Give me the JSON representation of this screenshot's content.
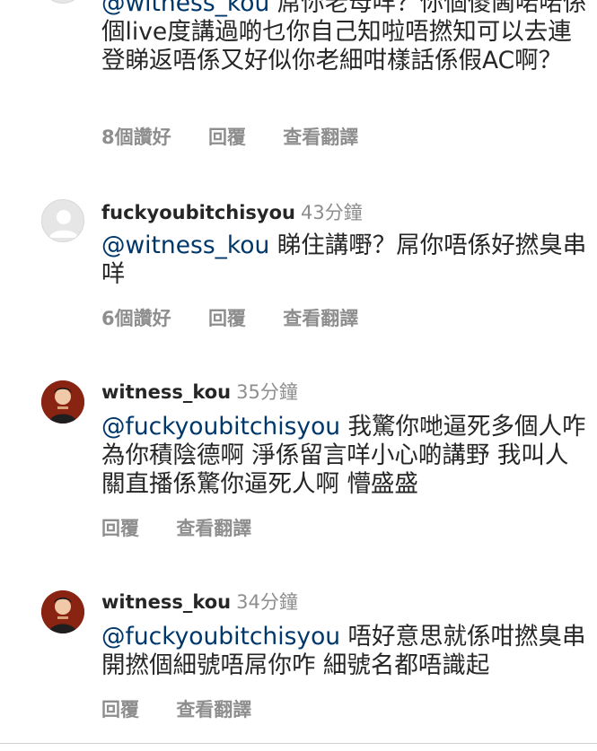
{
  "comments": [
    {
      "mention": "@witness_kou",
      "text": " 屌你老母咩？你個傻閪啱啱係個live度講過啲乜你自己知啦唔撚知可以去連登睇返唔係又好似你老細咁樣話係假AC啊？",
      "likes": "8個讚好",
      "reply": "回覆",
      "translate": "查看翻譯"
    },
    {
      "username": "fuckyoubitchisyou",
      "time": "43分鐘",
      "mention": "@witness_kou",
      "text": " 睇住講嘢？屌你唔係好撚臭串咩",
      "likes": "6個讚好",
      "reply": "回覆",
      "translate": "查看翻譯"
    },
    {
      "username": "witness_kou",
      "time": "35分鐘",
      "mention": "@fuckyoubitchisyou",
      "text": " 我驚你哋逼死多個人咋 為你積陰德啊 淨係留言咩小心啲講野 我叫人關直播係驚你逼死人啊 懵盛盛",
      "reply": "回覆",
      "translate": "查看翻譯"
    },
    {
      "username": "witness_kou",
      "time": "34分鐘",
      "mention": "@fuckyoubitchisyou",
      "text": " 唔好意思就係咁撚臭串 開撚個細號唔屌你咋 細號名都唔識起",
      "reply": "回覆",
      "translate": "查看翻譯"
    }
  ]
}
